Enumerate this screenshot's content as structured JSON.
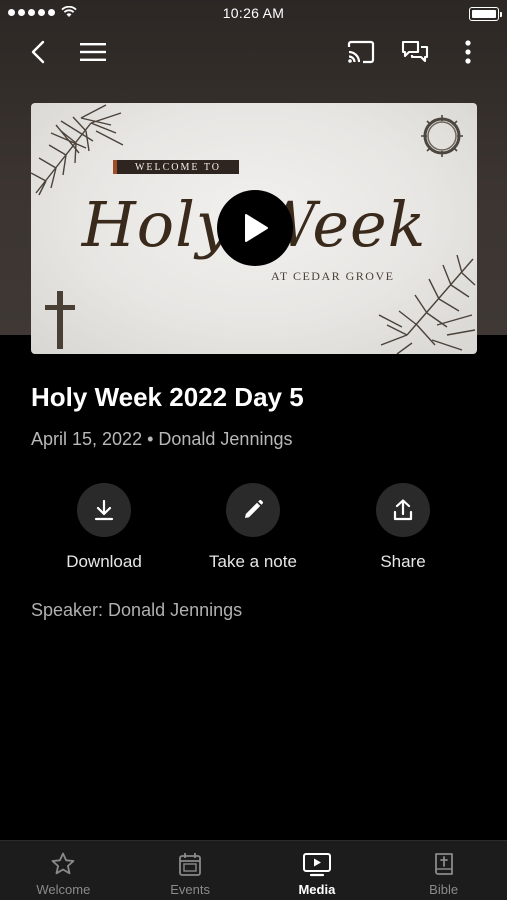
{
  "status_bar": {
    "time": "10:26 AM"
  },
  "video": {
    "banner": "WELCOME TO",
    "script_title": "Holy Week",
    "subtitle": "AT CEDAR GROVE"
  },
  "sermon": {
    "title": "Holy Week 2022 Day 5",
    "meta": "April 15, 2022 • Donald Jennings",
    "speaker": "Speaker: Donald Jennings"
  },
  "actions": [
    {
      "label": "Download",
      "icon": "download-icon"
    },
    {
      "label": "Take a note",
      "icon": "pencil-icon"
    },
    {
      "label": "Share",
      "icon": "share-icon"
    }
  ],
  "tabs": [
    {
      "label": "Welcome",
      "icon": "star-icon"
    },
    {
      "label": "Events",
      "icon": "calendar-icon"
    },
    {
      "label": "Media",
      "icon": "tv-play-icon",
      "active": true
    },
    {
      "label": "Bible",
      "icon": "bible-icon"
    }
  ]
}
